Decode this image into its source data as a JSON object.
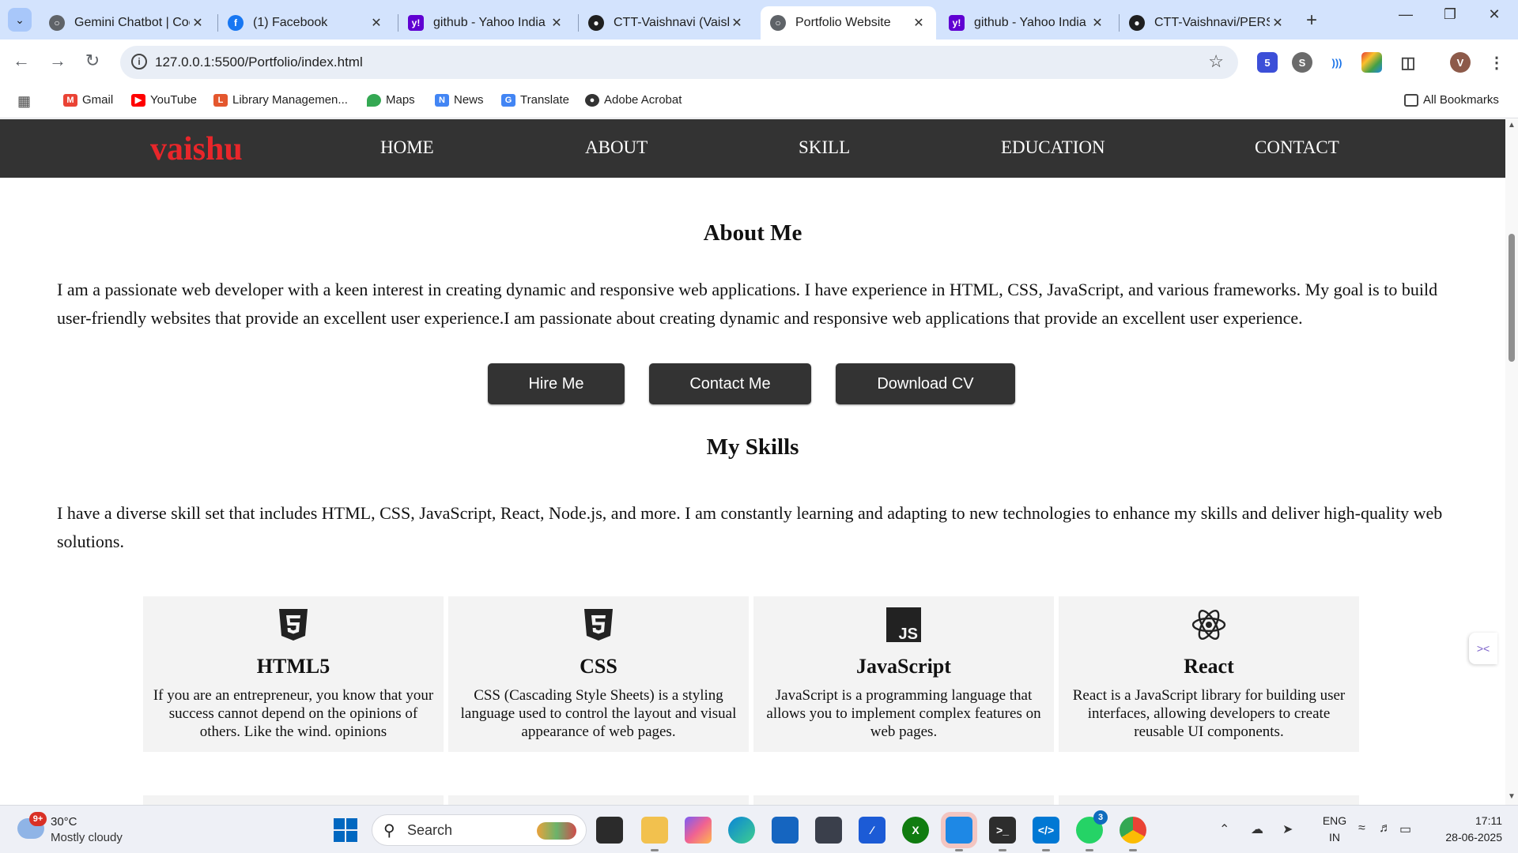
{
  "browser": {
    "tabs": [
      {
        "title": "Gemini Chatbot | Coc",
        "favicon": "globe-icon",
        "active": false
      },
      {
        "title": "(1) Facebook",
        "favicon": "facebook-icon",
        "active": false
      },
      {
        "title": "github - Yahoo India",
        "favicon": "yahoo-icon",
        "active": false
      },
      {
        "title": "CTT-Vaishnavi (Vaish",
        "favicon": "github-icon",
        "active": false
      },
      {
        "title": "Portfolio Website",
        "favicon": "globe-icon",
        "active": true
      },
      {
        "title": "github - Yahoo India",
        "favicon": "yahoo-icon",
        "active": false
      },
      {
        "title": "CTT-Vaishnavi/PERSC",
        "favicon": "github-icon",
        "active": false
      }
    ],
    "url": "127.0.0.1:5500/Portfolio/index.html",
    "profile_initial": "V",
    "extension_badge": "5",
    "bookmarks": [
      {
        "label": "Gmail",
        "icon": "gmail-icon"
      },
      {
        "label": "YouTube",
        "icon": "youtube-icon"
      },
      {
        "label": "Library Managemen...",
        "icon": "library-icon"
      },
      {
        "label": "Maps",
        "icon": "maps-icon"
      },
      {
        "label": "News",
        "icon": "news-icon"
      },
      {
        "label": "Translate",
        "icon": "translate-icon"
      },
      {
        "label": "Adobe Acrobat",
        "icon": "acrobat-icon"
      }
    ],
    "all_bookmarks": "All Bookmarks"
  },
  "site": {
    "logo": "vaishu",
    "nav": [
      "HOME",
      "ABOUT",
      "SKILL",
      "EDUCATION",
      "CONTACT"
    ],
    "about": {
      "heading": "About Me",
      "text": "I am a passionate web developer with a keen interest in creating dynamic and responsive web applications. I have experience in HTML, CSS, JavaScript, and various frameworks. My goal is to build user-friendly websites that provide an excellent user experience.I am passionate about creating dynamic and responsive web applications that provide an excellent user experience."
    },
    "buttons": [
      "Hire Me",
      "Contact Me",
      "Download CV"
    ],
    "skills": {
      "heading": "My Skills",
      "text": "I have a diverse skill set that includes HTML, CSS, JavaScript, React, Node.js, and more. I am constantly learning and adapting to new technologies to enhance my skills and deliver high-quality web solutions.",
      "cards": [
        {
          "title": "HTML5",
          "icon": "html5-icon",
          "desc": "If you are an entrepreneur, you know that your success cannot depend on the opinions of others. Like the wind. opinions"
        },
        {
          "title": "CSS",
          "icon": "css3-icon",
          "desc": "CSS (Cascading Style Sheets) is a styling language used to control the layout and visual appearance of web pages."
        },
        {
          "title": "JavaScript",
          "icon": "javascript-icon",
          "desc": "JavaScript is a programming language that allows you to implement complex features on web pages."
        },
        {
          "title": "React",
          "icon": "react-icon",
          "desc": "React is a JavaScript library for building user interfaces, allowing developers to create reusable UI components."
        }
      ]
    }
  },
  "taskbar": {
    "weather_temp": "30°C",
    "weather_desc": "Mostly cloudy",
    "weather_badge": "9+",
    "search_placeholder": "Search",
    "whatsapp_badge": "3",
    "lang_top": "ENG",
    "lang_bottom": "IN",
    "time": "17:11",
    "date": "28-06-2025"
  },
  "colors": {
    "nav_bg": "#333333",
    "logo": "#e8262a",
    "card_bg": "#f3f3f3",
    "tabstrip": "#d3e3fd"
  }
}
